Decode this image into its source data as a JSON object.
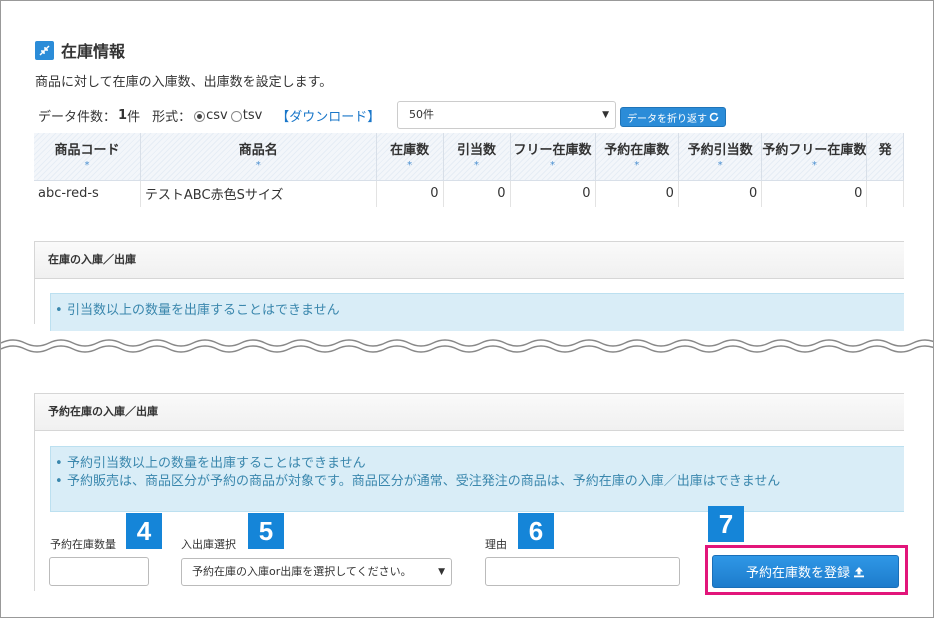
{
  "header": {
    "title": "在庫情報",
    "description": "商品に対して在庫の入庫数、出庫数を設定します。"
  },
  "controls": {
    "count_label": "データ件数：",
    "count_value": "1",
    "count_unit": "件",
    "format_label": "形式：",
    "format_csv": "csv",
    "format_tsv": "tsv",
    "format_selected": "csv",
    "download_label": "【ダウンロード】",
    "per_page_value": "50件",
    "wrap_button_label": "データを折り返す"
  },
  "table": {
    "columns": [
      "商品コード",
      "商品名",
      "在庫数",
      "引当数",
      "フリー在庫数",
      "予約在庫数",
      "予約引当数",
      "予約フリー在庫数",
      "発"
    ],
    "sort_marker": "*",
    "rows": [
      [
        "abc-red-s",
        "テストABC赤色Sサイズ",
        "0",
        "0",
        "0",
        "0",
        "0",
        "0",
        ""
      ]
    ]
  },
  "stock_panel": {
    "header": "在庫の入庫／出庫",
    "notes": [
      "引当数以上の数量を出庫することはできません"
    ]
  },
  "reserve_panel": {
    "header": "予約在庫の入庫／出庫",
    "notes": [
      "予約引当数以上の数量を出庫することはできません",
      "予約販売は、商品区分が予約の商品が対象です。商品区分が通常、受注発注の商品は、予約在庫の入庫／出庫はできません"
    ]
  },
  "form": {
    "quantity_label": "予約在庫数量",
    "quantity_value": "",
    "io_label": "入出庫選択",
    "io_select_value": "予約在庫の入庫or出庫を選択してください。",
    "reason_label": "理由",
    "reason_value": "",
    "register_button": "予約在庫数を登録"
  },
  "callouts": [
    "4",
    "5",
    "6",
    "7"
  ],
  "colors": {
    "accent": "#1585d8",
    "highlight": "#e2157a",
    "info_bg": "#d9edf7",
    "info_text": "#3a87ad"
  }
}
